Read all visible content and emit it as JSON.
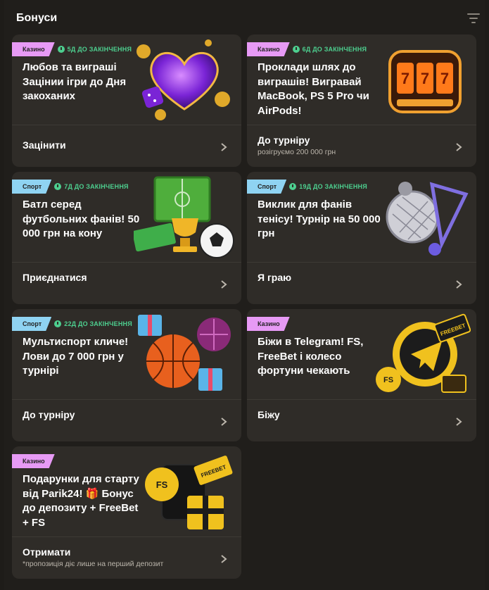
{
  "header": {
    "title": "Бонуси",
    "filter_icon": "filter-icon"
  },
  "cards": [
    {
      "category": "Казино",
      "category_color": "#e79af5",
      "timer": "5Д ДО ЗАКІНЧЕННЯ",
      "title": "Любов та виграші Зацінии ігри до Дня закоханих",
      "action": "Зацінити",
      "sub": "",
      "art_icon": "purple-heart-icon"
    },
    {
      "category": "Казино",
      "category_color": "#e79af5",
      "timer": "6Д ДО ЗАКІНЧЕННЯ",
      "title": "Проклади шлях до виграшів! Вигравай MacBook, PS 5 Pro чи AirPods!",
      "action": "До турніру",
      "sub": "розігруємо 200 000 грн",
      "art_icon": "slot-machine-icon"
    },
    {
      "category": "Спорт",
      "category_color": "#8fd3f2",
      "timer": "7Д ДО ЗАКІНЧЕННЯ",
      "title": "Батл серед футбольних фанів! 50 000 грн на кону",
      "action": "Приєднатися",
      "sub": "",
      "art_icon": "football-trophy-icon"
    },
    {
      "category": "Спорт",
      "category_color": "#8fd3f2",
      "timer": "19Д ДО ЗАКІНЧЕННЯ",
      "title": "Виклик для фанів тенісу! Турнір на 50 000 грн",
      "action": "Я граю",
      "sub": "",
      "art_icon": "tennis-racket-icon"
    },
    {
      "category": "Спорт",
      "category_color": "#8fd3f2",
      "timer": "22Д ДО ЗАКІНЧЕННЯ",
      "title": "Мультиспорт кличе! Лови до 7 000 грн у турнірі",
      "action": "До турніру",
      "sub": "",
      "art_icon": "basketball-gifts-icon"
    },
    {
      "category": "Казино",
      "category_color": "#e79af5",
      "timer": "",
      "title": "Біжи в Telegram! FS, FreeBet і колесо фортуни чекають",
      "action": "Біжу",
      "sub": "",
      "art_icon": "telegram-coin-icon"
    },
    {
      "category": "Казино",
      "category_color": "#e79af5",
      "timer": "",
      "title": "Подарунки для старту від Parik24! 🎁 Бонус до депозиту + FreeBet + FS",
      "action": "Отримати",
      "sub": "*пропозиція діє лише на перший депозит",
      "art_icon": "freebet-gift-icon"
    }
  ]
}
